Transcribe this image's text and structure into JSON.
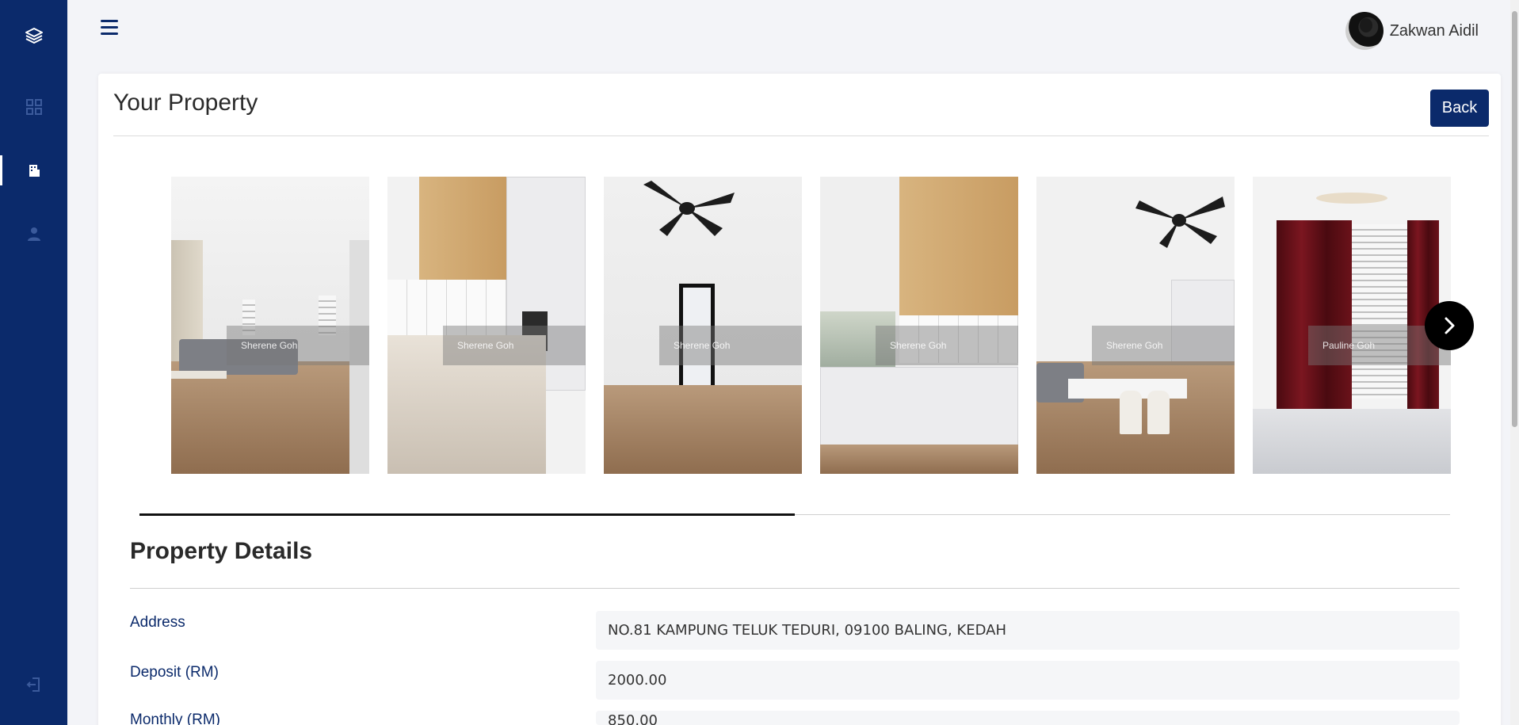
{
  "sidebar": {
    "items": [
      {
        "icon": "layers-icon",
        "active": false
      },
      {
        "icon": "grid-icon",
        "active": false
      },
      {
        "icon": "building-icon",
        "active": true
      },
      {
        "icon": "user-icon",
        "active": false
      },
      {
        "icon": "logout-icon",
        "active": false
      }
    ],
    "colors": {
      "background": "#0b2a6b",
      "icon_muted": "#3b5a9b",
      "icon_active": "#ffffff"
    }
  },
  "header": {
    "menu_icon": "hamburger-icon",
    "user_name": "Zakwan Aidil"
  },
  "page": {
    "title": "Your Property",
    "back_label": "Back"
  },
  "gallery": {
    "photos": [
      {
        "watermark": "Sherene Goh",
        "scene": "living room"
      },
      {
        "watermark": "Sherene Goh",
        "scene": "kitchen"
      },
      {
        "watermark": "Sherene Goh",
        "scene": "ceiling fan and door"
      },
      {
        "watermark": "Sherene Goh",
        "scene": "kitchen"
      },
      {
        "watermark": "Sherene Goh",
        "scene": "dining area"
      },
      {
        "watermark": "Pauline Goh",
        "scene": "bedroom curtains"
      }
    ],
    "next_icon": "chevron-right-icon",
    "progress": 0.5
  },
  "details": {
    "title": "Property Details",
    "fields": [
      {
        "label": "Address",
        "value": "NO.81 KAMPUNG TELUK TEDURI, 09100 BALING, KEDAH"
      },
      {
        "label": "Deposit (RM)",
        "value": "2000.00"
      },
      {
        "label": "Monthly (RM)",
        "value": "850.00"
      }
    ]
  }
}
